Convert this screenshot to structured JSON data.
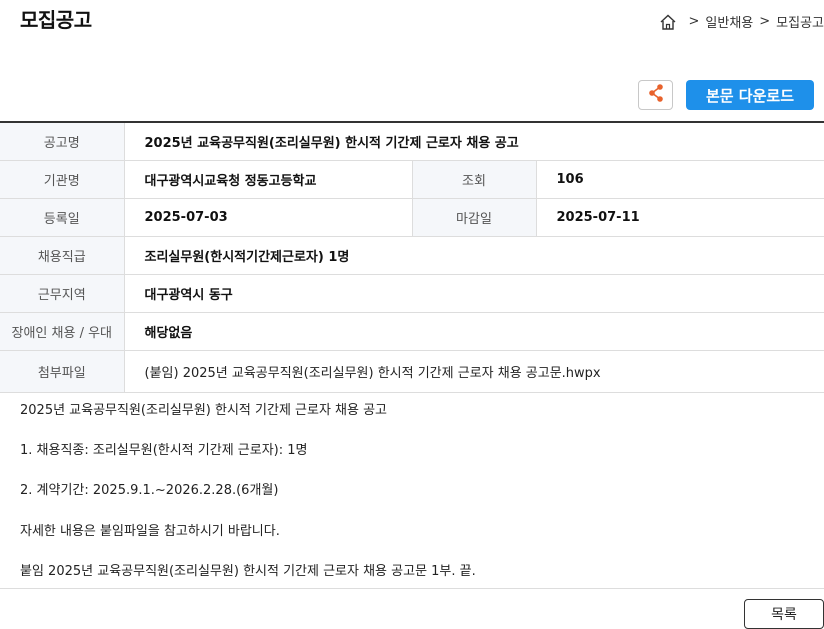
{
  "page": {
    "title": "모집공고"
  },
  "breadcrumb": {
    "separator": ">",
    "items": [
      "일반채용",
      "모집공고"
    ]
  },
  "actions": {
    "download_label": "본문 다운로드",
    "list_label": "목록"
  },
  "colors": {
    "accent": "#1e90ea",
    "share_icon": "#e8622c"
  },
  "fields": {
    "title": {
      "label": "공고명",
      "value": "2025년 교육공무직원(조리실무원) 한시적 기간제 근로자 채용 공고"
    },
    "agency": {
      "label": "기관명",
      "value": "대구광역시교육청 정동고등학교"
    },
    "views": {
      "label": "조회",
      "value": "106"
    },
    "registered": {
      "label": "등록일",
      "value": "2025-07-03"
    },
    "deadline": {
      "label": "마감일",
      "value": "2025-07-11"
    },
    "position": {
      "label": "채용직급",
      "value": "조리실무원(한시적기간제근로자) 1명"
    },
    "location": {
      "label": "근무지역",
      "value": "대구광역시 동구"
    },
    "disability": {
      "label": "장애인 채용 / 우대",
      "value": "해당없음"
    },
    "attachment": {
      "label": "첨부파일",
      "value": "(붙임) 2025년 교육공무직원(조리실무원) 한시적 기간제 근로자 채용 공고문.hwpx"
    }
  },
  "body": {
    "lines": [
      "2025년 교육공무직원(조리실무원) 한시적 기간제 근로자 채용 공고",
      "1. 채용직종: 조리실무원(한시적 기간제 근로자): 1명",
      "2. 계약기간: 2025.9.1.~2026.2.28.(6개월)",
      "자세한 내용은 붙임파일을 참고하시기 바랍니다.",
      "붙임 2025년 교육공무직원(조리실무원) 한시적 기간제 근로자 채용 공고문 1부. 끝."
    ]
  }
}
